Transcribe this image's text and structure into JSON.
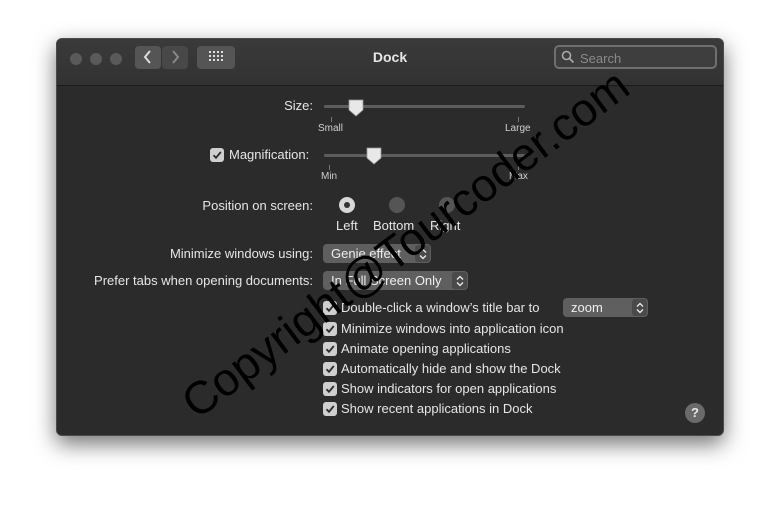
{
  "window": {
    "title": "Dock"
  },
  "search": {
    "placeholder": "Search"
  },
  "size": {
    "label": "Size:",
    "min_label": "Small",
    "max_label": "Large",
    "value_fraction": 0.16
  },
  "magnification": {
    "label": "Magnification:",
    "checked": true,
    "min_label": "Min",
    "max_label": "Max",
    "value_fraction": 0.25
  },
  "position": {
    "label": "Position on screen:",
    "options": [
      "Left",
      "Bottom",
      "Right"
    ],
    "selected": "Left"
  },
  "minimize": {
    "label": "Minimize windows using:",
    "value": "Genie effect"
  },
  "prefer_tabs": {
    "label": "Prefer tabs when opening documents:",
    "value": "In Full Screen Only"
  },
  "double_click": {
    "label": "Double-click a window’s title bar to",
    "value": "zoom"
  },
  "checkboxes": [
    {
      "label": "Minimize windows into application icon",
      "checked": true
    },
    {
      "label": "Animate opening applications",
      "checked": true
    },
    {
      "label": "Automatically hide and show the Dock",
      "checked": true
    },
    {
      "label": "Show indicators for open applications",
      "checked": true
    },
    {
      "label": "Show recent applications in Dock",
      "checked": true
    }
  ],
  "help": {
    "label": "?"
  },
  "watermark": {
    "text": "Copyright@Tourcoder.com"
  }
}
